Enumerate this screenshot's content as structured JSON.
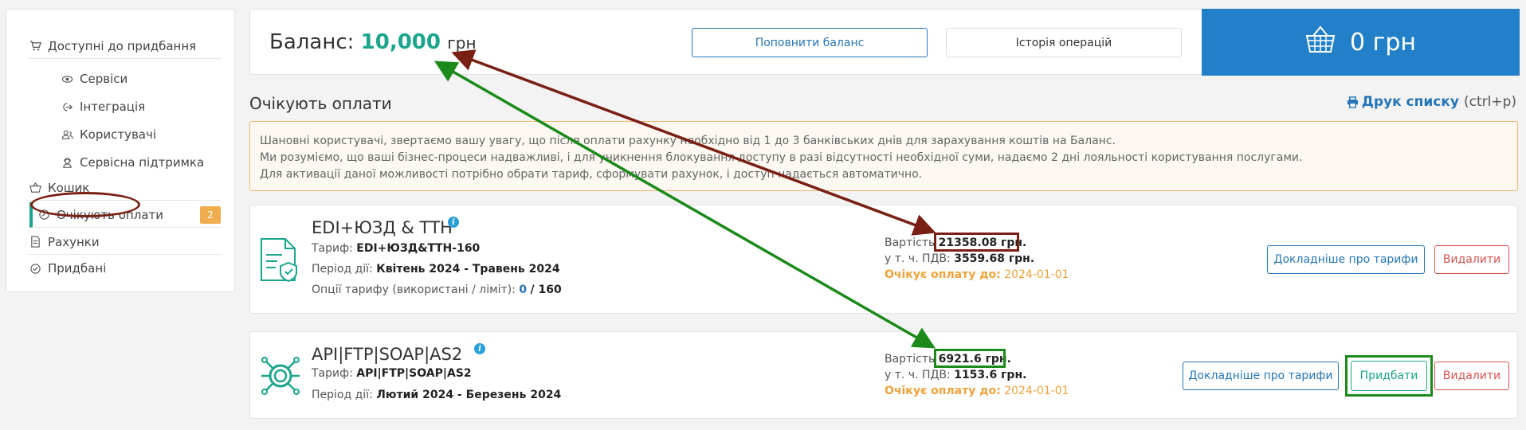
{
  "sidebar": {
    "available": "Доступні до придбання",
    "services": "Сервіси",
    "integration": "Інтеграція",
    "users": "Користувачі",
    "support": "Сервісна підтримка",
    "cart": "Кошик",
    "awaiting": "Очікують оплати",
    "awaiting_count": "2",
    "invoices": "Рахунки",
    "purchased": "Придбані"
  },
  "balance": {
    "label": "Баланс:",
    "value": "10,000",
    "unit": "грн",
    "topup_button": "Поповнити баланс",
    "history_button": "Історія операцій",
    "cart_total": "0 грн"
  },
  "section": {
    "title": "Очікують оплати",
    "print_label": "Друк списку",
    "print_hint": "(ctrl+p)"
  },
  "notice": {
    "line1": "Шановні користувачі, звертаємо вашу увагу, що після оплати рахунку необхідно від 1 до 3 банківських днів для зарахування коштів на Баланс.",
    "line2": "Ми розуміємо, що ваші бізнес-процеси надважливі, і для уникнення блокування доступу в разі відсутності необхідної суми, надаємо 2 дні лояльності користування послугами.",
    "line3": "Для активації даної можливості потрібно обрати тариф, сформувати рахунок, і доступ надається автоматично."
  },
  "cards": [
    {
      "title": "EDI+ЮЗД & ТТН",
      "tariff_label": "Тариф:",
      "tariff": "EDI+ЮЗД&ТТН-160",
      "period_label": "Період дії:",
      "period": "Квітень 2024 - Травень 2024",
      "options_label": "Опції тарифу (використані / ліміт):",
      "options_used": "0",
      "options_limit": "/ 160",
      "cost_label": "Вартість",
      "cost": "21358.08 грн.",
      "vat_label": "у т. ч. ПДВ:",
      "vat": "3559.68 грн.",
      "wait_label": "Очікує оплату до:",
      "wait_date": "2024-01-01",
      "details_button": "Докладніше про тарифи",
      "delete_button": "Видалити"
    },
    {
      "title": "API|FTP|SOAP|AS2",
      "tariff_label": "Тариф:",
      "tariff": "API|FTP|SOAP|AS2",
      "period_label": "Період дії:",
      "period": "Лютий 2024 - Березень 2024",
      "cost_label": "Вартість",
      "cost": "6921.6 грн.",
      "vat_label": "у т. ч. ПДВ:",
      "vat": "1153.6 грн.",
      "wait_label": "Очікує оплату до:",
      "wait_date": "2024-01-01",
      "details_button": "Докладніше про тарифи",
      "buy_button": "Придбати",
      "delete_button": "Видалити"
    }
  ],
  "colors": {
    "accent_teal": "#1aa58c",
    "primary_blue": "#2576b8",
    "cart_blue": "#2280c8",
    "annotation_red": "#7a1f14",
    "annotation_green": "#1b8a1b",
    "warning_orange": "#f0a23a"
  }
}
